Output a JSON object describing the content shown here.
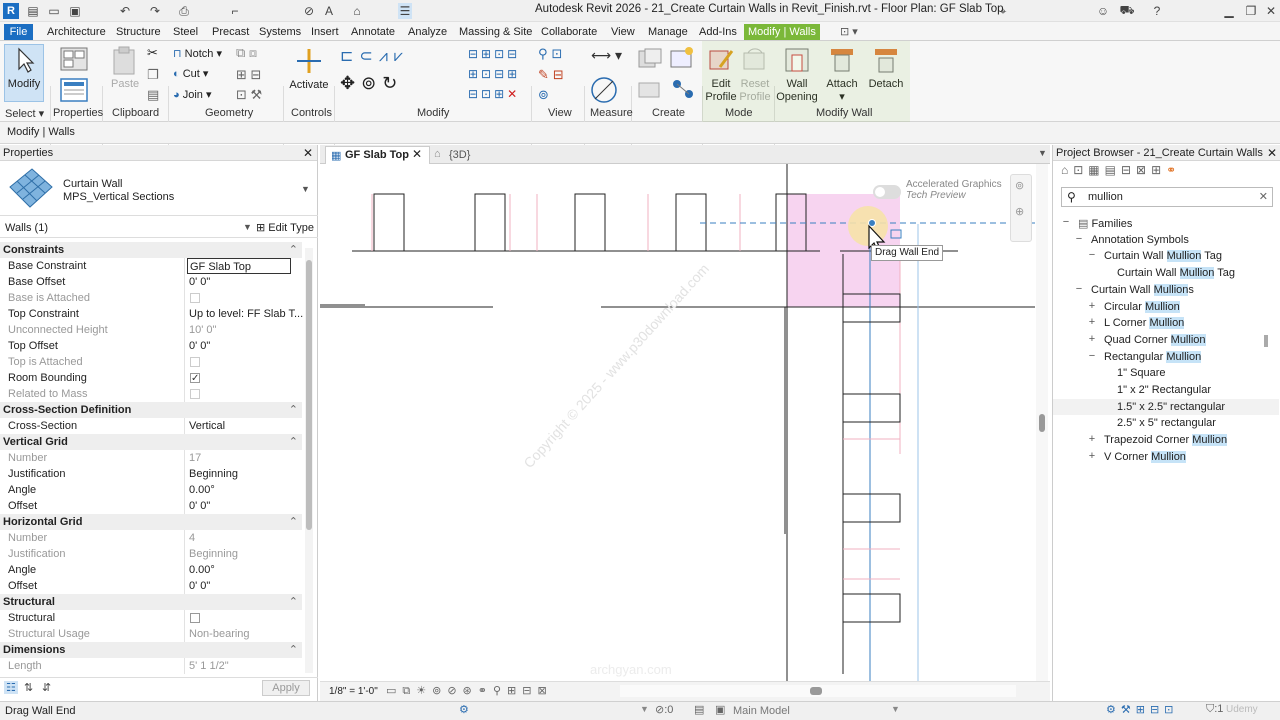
{
  "title": "Autodesk Revit 2026 - 21_Create Curtain Walls in Revit_Finish.rvt - Floor Plan: GF Slab Top",
  "menu": {
    "file": "File",
    "items": [
      "Architecture",
      "Structure",
      "Steel",
      "Precast",
      "Systems",
      "Insert",
      "Annotate",
      "Analyze",
      "Massing & Site",
      "Collaborate",
      "View",
      "Manage",
      "Add-Ins"
    ],
    "active": "Modify | Walls"
  },
  "ribbon": {
    "modify": "Modify",
    "paste": "Paste",
    "notch": "Notch",
    "cut": "Cut",
    "join": "Join",
    "activate": "Activate",
    "edit_profile": [
      "Edit",
      "Profile"
    ],
    "reset_profile": [
      "Reset",
      "Profile"
    ],
    "wall_opening": [
      "Wall",
      "Opening"
    ],
    "attach": "Attach",
    "detach": "Detach",
    "panels": [
      "Select",
      "Properties",
      "Clipboard",
      "Geometry",
      "Controls",
      "Modify",
      "View",
      "Measure",
      "Create",
      "Mode",
      "Modify Wall"
    ]
  },
  "context_label": "Modify | Walls",
  "properties": {
    "header": "Properties",
    "type_family": "Curtain Wall",
    "type_name": "MPS_Vertical Sections",
    "instance_filter": "Walls (1)",
    "edit_type": "Edit Type",
    "rows": [
      {
        "group": "Constraints"
      },
      {
        "k": "Base Constraint",
        "v": "GF Slab Top",
        "boxed": true
      },
      {
        "k": "Base Offset",
        "v": "0'  0\""
      },
      {
        "k": "Base is Attached",
        "check": false,
        "dim": true
      },
      {
        "k": "Top Constraint",
        "v": "Up to level: FF Slab T..."
      },
      {
        "k": "Unconnected Height",
        "v": "10'  0\"",
        "dim": true
      },
      {
        "k": "Top Offset",
        "v": "0'  0\""
      },
      {
        "k": "Top is Attached",
        "check": false,
        "dim": true
      },
      {
        "k": "Room Bounding",
        "check": true
      },
      {
        "k": "Related to Mass",
        "check": false,
        "dim": true
      },
      {
        "group": "Cross-Section Definition"
      },
      {
        "k": "Cross-Section",
        "v": "Vertical"
      },
      {
        "group": "Vertical Grid"
      },
      {
        "k": "Number",
        "v": "17",
        "dim": true
      },
      {
        "k": "Justification",
        "v": "Beginning"
      },
      {
        "k": "Angle",
        "v": "0.00°"
      },
      {
        "k": "Offset",
        "v": "0'  0\""
      },
      {
        "group": "Horizontal Grid"
      },
      {
        "k": "Number",
        "v": "4",
        "dim": true
      },
      {
        "k": "Justification",
        "v": "Beginning",
        "dim": true
      },
      {
        "k": "Angle",
        "v": "0.00°"
      },
      {
        "k": "Offset",
        "v": "0'  0\""
      },
      {
        "group": "Structural"
      },
      {
        "k": "Structural",
        "check": false
      },
      {
        "k": "Structural Usage",
        "v": "Non-bearing",
        "dim": true
      },
      {
        "group": "Dimensions"
      },
      {
        "k": "Length",
        "v": "5'  1 1/2\"",
        "dim": true
      }
    ],
    "apply": "Apply"
  },
  "view": {
    "tab_active": "GF Slab Top",
    "tab_other": "{3D}",
    "tooltip": "Drag Wall End",
    "accel_line1": "Accelerated Graphics",
    "accel_line2": "Tech Preview",
    "scale": "1/8\" = 1'-0\"",
    "watermark": "Copyright © 2025 - www.p30download.com",
    "watermark2": "archgyan.com"
  },
  "browser": {
    "header": "Project Browser - 21_Create Curtain Walls in R...",
    "search": "mullion",
    "tree": [
      {
        "level": 0,
        "toggle": "−",
        "pre": "Families",
        "hl": "",
        "post": ""
      },
      {
        "level": 1,
        "toggle": "−",
        "pre": "Annotation Symbols",
        "hl": "",
        "post": ""
      },
      {
        "level": 2,
        "toggle": "−",
        "pre": "Curtain Wall ",
        "hl": "Mullion",
        "post": " Tag"
      },
      {
        "level": 3,
        "toggle": "",
        "pre": "Curtain Wall ",
        "hl": "Mullion",
        "post": " Tag"
      },
      {
        "level": 1,
        "toggle": "−",
        "pre": "Curtain Wall ",
        "hl": "Mullion",
        "post": "s"
      },
      {
        "level": 2,
        "toggle": "+",
        "pre": "Circular ",
        "hl": "Mullion",
        "post": ""
      },
      {
        "level": 2,
        "toggle": "+",
        "pre": "L Corner ",
        "hl": "Mullion",
        "post": ""
      },
      {
        "level": 2,
        "toggle": "+",
        "pre": "Quad Corner ",
        "hl": "Mullion",
        "post": ""
      },
      {
        "level": 2,
        "toggle": "−",
        "pre": "Rectangular ",
        "hl": "Mullion",
        "post": ""
      },
      {
        "level": 3,
        "toggle": "",
        "pre": "1\" Square",
        "hl": "",
        "post": ""
      },
      {
        "level": 3,
        "toggle": "",
        "pre": "1\" x 2\" Rectangular",
        "hl": "",
        "post": ""
      },
      {
        "level": 3,
        "toggle": "",
        "pre": "1.5\" x 2.5\" rectangular",
        "hl": "",
        "post": "",
        "selected": true
      },
      {
        "level": 3,
        "toggle": "",
        "pre": "2.5\" x 5\" rectangular",
        "hl": "",
        "post": ""
      },
      {
        "level": 2,
        "toggle": "+",
        "pre": "Trapezoid Corner ",
        "hl": "Mullion",
        "post": ""
      },
      {
        "level": 2,
        "toggle": "+",
        "pre": "V Corner ",
        "hl": "Mullion",
        "post": ""
      }
    ]
  },
  "status": {
    "left": "Drag Wall End",
    "model": "Main Model",
    "count": ":0",
    "filter": ":1",
    "udemy": "Udemy"
  }
}
